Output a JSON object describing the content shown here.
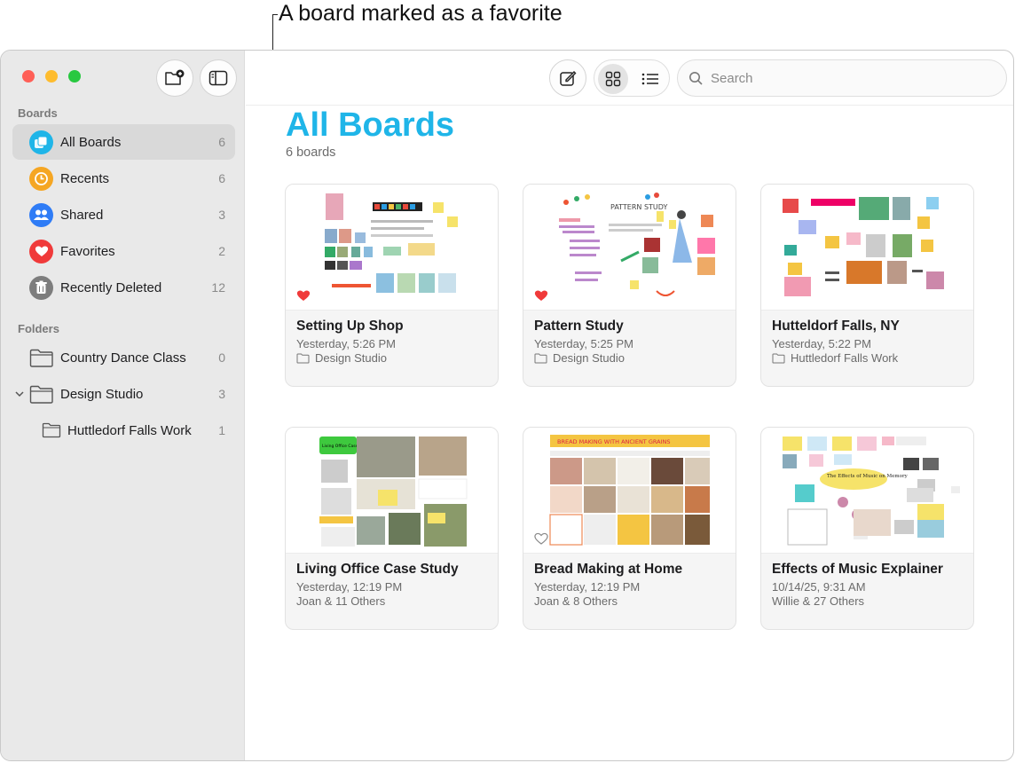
{
  "callout": {
    "text": "A board marked as a favorite"
  },
  "sidebar": {
    "boards_label": "Boards",
    "boards": [
      {
        "label": "All Boards",
        "count": "6",
        "icon": "all-boards-icon",
        "color": "#1fb5e8",
        "selected": true
      },
      {
        "label": "Recents",
        "count": "6",
        "icon": "clock-icon",
        "color": "#f5a623"
      },
      {
        "label": "Shared",
        "count": "3",
        "icon": "people-icon",
        "color": "#2f7cf6"
      },
      {
        "label": "Favorites",
        "count": "2",
        "icon": "heart-icon",
        "color": "#f03a3a"
      },
      {
        "label": "Recently Deleted",
        "count": "12",
        "icon": "trash-icon",
        "color": "#7d7d7d"
      }
    ],
    "folders_label": "Folders",
    "folders": [
      {
        "label": "Country Dance Class",
        "count": "0"
      },
      {
        "label": "Design Studio",
        "count": "3"
      },
      {
        "label": "Huttledorf Falls Work",
        "count": "1"
      }
    ]
  },
  "toolbar": {
    "search_placeholder": "Search"
  },
  "main": {
    "title": "All Boards",
    "subtitle": "6 boards",
    "cards": [
      {
        "title": "Setting Up Shop",
        "date": "Yesterday, 5:26 PM",
        "meta": "Design Studio",
        "favorite": true
      },
      {
        "title": "Pattern Study",
        "date": "Yesterday, 5:25 PM",
        "meta": "Design Studio",
        "favorite": true
      },
      {
        "title": "Hutteldorf Falls, NY",
        "date": "Yesterday, 5:22 PM",
        "meta": "Huttledorf Falls Work",
        "favorite": false
      },
      {
        "title": "Living Office Case Study",
        "date": "Yesterday, 12:19 PM",
        "meta": "Joan & 11 Others",
        "favorite": false
      },
      {
        "title": "Bread Making at Home",
        "date": "Yesterday, 12:19 PM",
        "meta": "Joan & 8 Others",
        "favorite": false
      },
      {
        "title": "Effects of Music Explainer",
        "date": "10/14/25, 9:31 AM",
        "meta": "Willie & 27 Others",
        "favorite": false
      }
    ],
    "thumb_texts": {
      "living_office": "Living Office Case Study",
      "bread_banner": "BREAD MAKING WITH ANCIENT GRAINS",
      "music_title": "The Effects of Music on Memory",
      "pattern_title": "PATTERN STUDY"
    }
  }
}
